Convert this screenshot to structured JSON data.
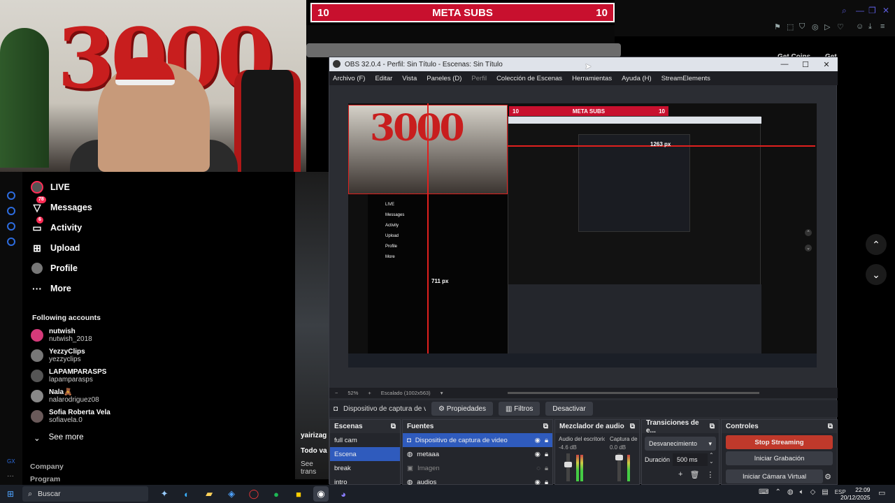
{
  "banner": {
    "left_num": "10",
    "title": "META SUBS",
    "right_num": "10"
  },
  "sidebar": {
    "items": [
      {
        "label": "LIVE",
        "icon": "live-avatar-icon"
      },
      {
        "label": "Messages",
        "icon": "messages-icon",
        "badge": "78"
      },
      {
        "label": "Activity",
        "icon": "activity-icon",
        "badge": "6"
      },
      {
        "label": "Upload",
        "icon": "upload-icon"
      },
      {
        "label": "Profile",
        "icon": "profile-icon"
      },
      {
        "label": "More",
        "icon": "more-icon"
      }
    ],
    "following_header": "Following accounts",
    "accounts": [
      {
        "name": "nutwish",
        "user": "nutwish_2018"
      },
      {
        "name": "YezzyClips",
        "user": "yezzyclips"
      },
      {
        "name": "LAPAMPARASPS",
        "user": "lapamparasps"
      },
      {
        "name": "Nala🧸",
        "user": "nalarodriguez08"
      },
      {
        "name": "Sofia Roberta Vela",
        "user": "sofiavela.0"
      }
    ],
    "see_more": "See more",
    "company": "Company",
    "program": "Program"
  },
  "midstrip": {
    "user": "yairizag",
    "text1": "Todo va",
    "text2": "See trans"
  },
  "topbar": {
    "get_coins": "Get Coins",
    "get_app": "Get App"
  },
  "obs": {
    "title": "OBS 32.0.4 - Perfil: Sin Título - Escenas: Sin Título",
    "menu": [
      "Archivo (F)",
      "Editar",
      "Vista",
      "Paneles (D)",
      "Perfil",
      "Colección de Escenas",
      "Herramientas",
      "Ayuda (H)",
      "StreamElements"
    ],
    "preview_label_w": "1263 px",
    "preview_label_h": "711 px",
    "zoom": "52%",
    "scale": "Escalado (1002x563)",
    "source_bar": {
      "source": "Dispositivo de captura de v",
      "props": "Propiedades",
      "filters": "Filtros",
      "disable": "Desactivar"
    },
    "scenes": {
      "title": "Escenas",
      "items": [
        "full cam",
        "Escena",
        "break",
        "intro"
      ],
      "selected": 1
    },
    "sources": {
      "title": "Fuentes",
      "items": [
        "Dispositivo de captura de video",
        "metaaa",
        "Imagen",
        "audios"
      ]
    },
    "mixer": {
      "title": "Mezclador de audio",
      "ch1": "Audio del escritorio",
      "ch1_db": "-4.6 dB",
      "ch2": "Captura de",
      "ch2_db": "0.0 dB"
    },
    "transitions": {
      "title": "Transiciones de e...",
      "type": "Desvanecimiento",
      "duration_label": "Duración",
      "duration": "500 ms"
    },
    "controls": {
      "title": "Controles",
      "stream": "Stop Streaming",
      "record": "Iniciar Grabación",
      "vcam": "Iniciar Cámara Virtual"
    }
  },
  "taskbar": {
    "search": "Buscar",
    "lang": "ESP",
    "time": "22:09",
    "date": "20/12/2025"
  },
  "colors": {
    "accent_red": "#c8102e",
    "obs_stream_button": "#c0392b",
    "obs_select": "#2f5bbd",
    "tiktok_badge": "#fe2c55"
  }
}
